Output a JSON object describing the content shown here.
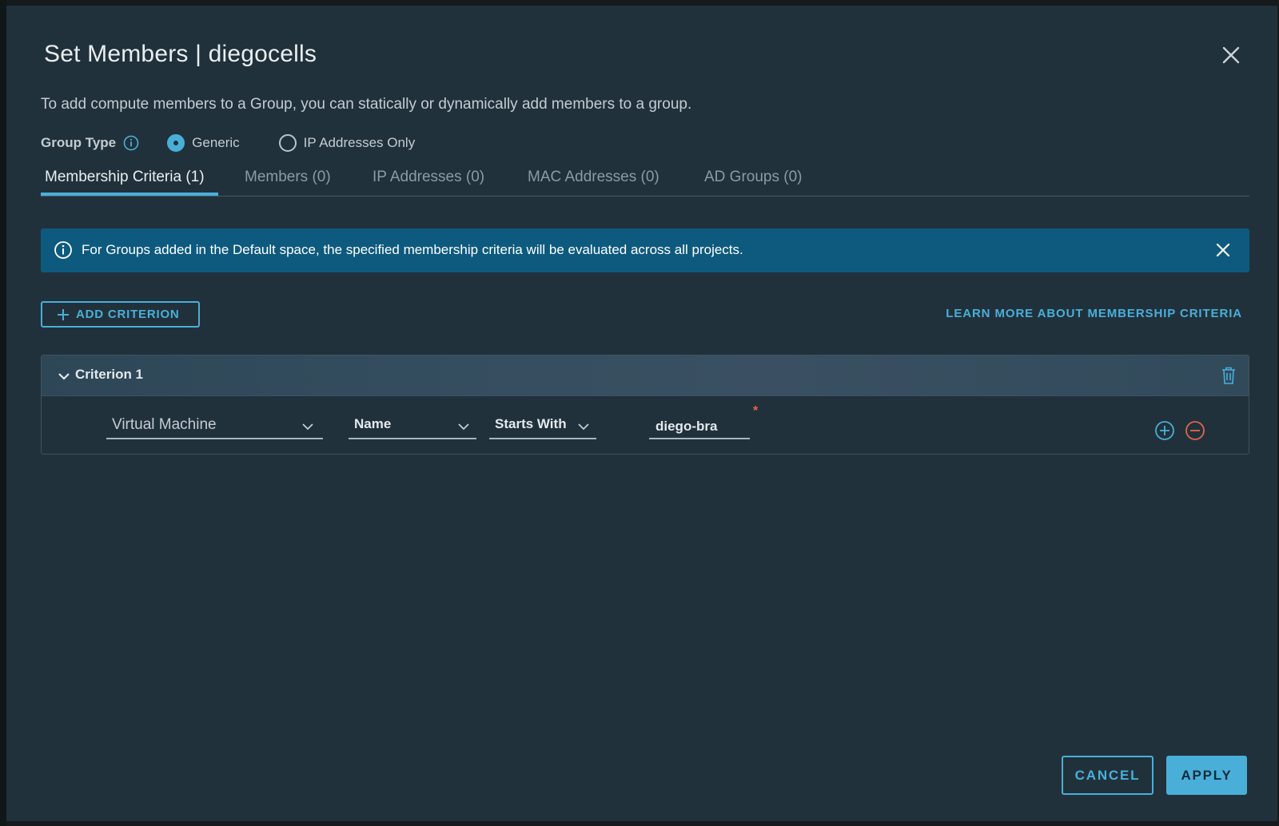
{
  "modal": {
    "title": "Set Members | diegocells",
    "description": "To add compute members to a Group, you can statically or dynamically add members to a group.",
    "group_type": {
      "label": "Group Type",
      "options": [
        {
          "label": "Generic",
          "selected": true
        },
        {
          "label": "IP Addresses Only",
          "selected": false
        }
      ]
    },
    "tabs": [
      {
        "label": "Membership Criteria (1)",
        "active": true
      },
      {
        "label": "Members (0)",
        "active": false
      },
      {
        "label": "IP Addresses (0)",
        "active": false
      },
      {
        "label": "MAC Addresses (0)",
        "active": false
      },
      {
        "label": "AD Groups (0)",
        "active": false
      }
    ],
    "alert": {
      "text": "For Groups added in the Default space, the specified membership criteria will be evaluated across all projects."
    },
    "add_criterion_label": "ADD CRITERION",
    "learn_more_label": "LEARN MORE ABOUT MEMBERSHIP CRITERIA",
    "criterion": {
      "title": "Criterion 1",
      "row": {
        "member_type": "Virtual Machine",
        "property": "Name",
        "operator": "Starts With",
        "value": "diego-bra",
        "required_mark": "*"
      }
    },
    "cancel_label": "CANCEL",
    "apply_label": "APPLY"
  },
  "colors": {
    "accent": "#49afd9",
    "alert_bg": "#0e5a7e",
    "modal_bg": "#21313b",
    "danger": "#e0664d"
  },
  "icons": [
    "close-icon",
    "info-icon",
    "plus-icon",
    "chevron-down-icon",
    "trash-icon",
    "add-circle-icon",
    "remove-circle-icon"
  ]
}
